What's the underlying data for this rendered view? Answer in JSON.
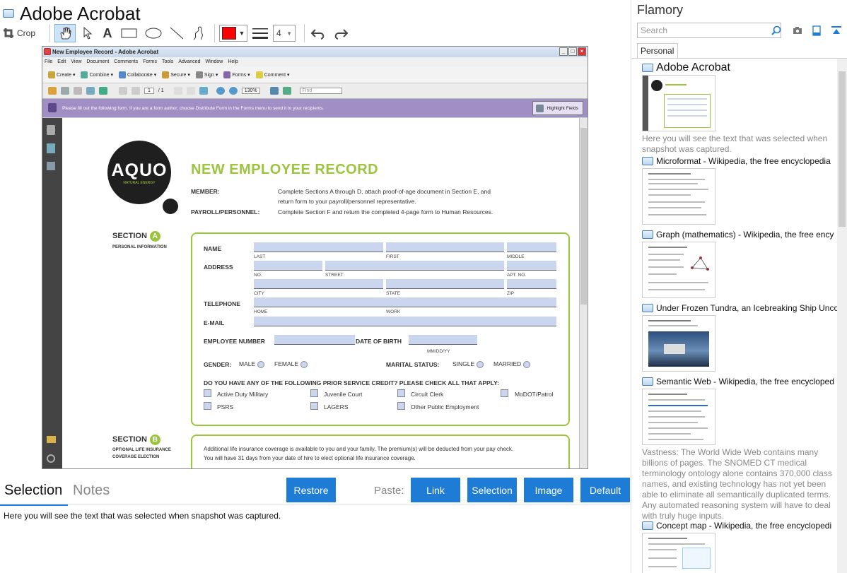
{
  "app": {
    "title": "Adobe Acrobat"
  },
  "toolbar": {
    "crop_label": "Crop",
    "line_width_value": "4",
    "color": "#ff0000"
  },
  "snapshot": {
    "window_title": "New Employee Record - Adobe Acrobat",
    "menu": [
      "File",
      "Edit",
      "View",
      "Document",
      "Comments",
      "Forms",
      "Tools",
      "Advanced",
      "Window",
      "Help"
    ],
    "tasks": [
      "Create",
      "Combine",
      "Collaborate",
      "Secure",
      "Sign",
      "Forms",
      "Comment"
    ],
    "page_field": "1",
    "page_total": "/ 1",
    "zoom": "130%",
    "find_placeholder": "Find",
    "message": "Please fill out the following form. If you are a form author, choose Distribute Form in the Forms menu to send it to your recipients.",
    "highlight_label": "Highlight Fields",
    "form": {
      "logo_text": "AQUO",
      "logo_sub": "NATURAL ENERGY",
      "title": "NEW EMPLOYEE RECORD",
      "member_label": "MEMBER:",
      "member_text1": "Complete Sections A through D, attach proof-of-age document in Section E, and",
      "member_text2": "return form to your payroll/personnel representative.",
      "payroll_label": "PAYROLL/PERSONNEL:",
      "payroll_text": "Complete Section F and return the completed 4-page form to Human Resources.",
      "section_a": "SECTION",
      "section_a_letter": "A",
      "section_a_sub": "PERSONAL INFORMATION",
      "name_label": "NAME",
      "last": "LAST",
      "first": "FIRST",
      "middle": "MIDDLE",
      "address_label": "ADDRESS",
      "no": "NO.",
      "street": "STREET",
      "apt": "APT. NO.",
      "city": "CITY",
      "state": "STATE",
      "zip": "ZIP",
      "telephone_label": "TELEPHONE",
      "home": "HOME",
      "work": "WORK",
      "email_label": "E-MAIL",
      "empnum_label": "EMPLOYEE NUMBER",
      "dob_label": "DATE OF BIRTH",
      "dob_fmt": "MM/DD/YY",
      "gender_label": "GENDER:",
      "male": "MALE",
      "female": "FEMALE",
      "marital_label": "MARITAL STATUS:",
      "single": "SINGLE",
      "married": "MARRIED",
      "prior_q": "DO YOU HAVE ANY OF THE FOLLOWING PRIOR SERVICE CREDIT? PLEASE CHECK ALL THAT APPLY:",
      "opt1": "Active Duty Military",
      "opt2": "Juvenile Court",
      "opt3": "Circuit Clerk",
      "opt4": "MoDOT/Patrol",
      "opt5": "PSRS",
      "opt6": "LAGERS",
      "opt7": "Other Public Employment",
      "section_b": "SECTION",
      "section_b_letter": "B",
      "section_b_sub1": "OPTIONAL LIFE INSURANCE",
      "section_b_sub2": "COVERAGE ELECTION",
      "b_text1": "Additional life insurance coverage is available to you and your family. The premium(s) will be deducted from your pay check.",
      "b_text2": "You will have 31 days from your date of hire to elect optional life insurance coverage."
    }
  },
  "bottom": {
    "tab_selection": "Selection",
    "tab_notes": "Notes",
    "restore": "Restore",
    "paste_label": "Paste:",
    "link": "Link",
    "selection": "Selection",
    "image": "Image",
    "default": "Default",
    "selected_text": "Here you will see the text that was selected when snapshot was captured."
  },
  "sidebar": {
    "title": "Flamory",
    "search_placeholder": "Search",
    "tab_personal": "Personal",
    "items": [
      {
        "title": "Adobe Acrobat",
        "desc": "Here you will see the text that was selected when snapshot was captured."
      },
      {
        "title": "Microformat - Wikipedia, the free encyclopedia"
      },
      {
        "title": "Graph (mathematics) - Wikipedia, the free ency"
      },
      {
        "title": "Under Frozen Tundra, an Icebreaking Ship Unco"
      },
      {
        "title": "Semantic Web - Wikipedia, the free encycloped",
        "desc": "Vastness: The World Wide Web contains many billions of pages. The SNOMED CT medical terminology ontology alone contains 370,000 class names, and existing technology has not yet been able to eliminate all semantically duplicated terms. Any automated reasoning system will have to deal with truly huge inputs."
      },
      {
        "title": "Concept map - Wikipedia, the free encyclopedi"
      }
    ]
  }
}
